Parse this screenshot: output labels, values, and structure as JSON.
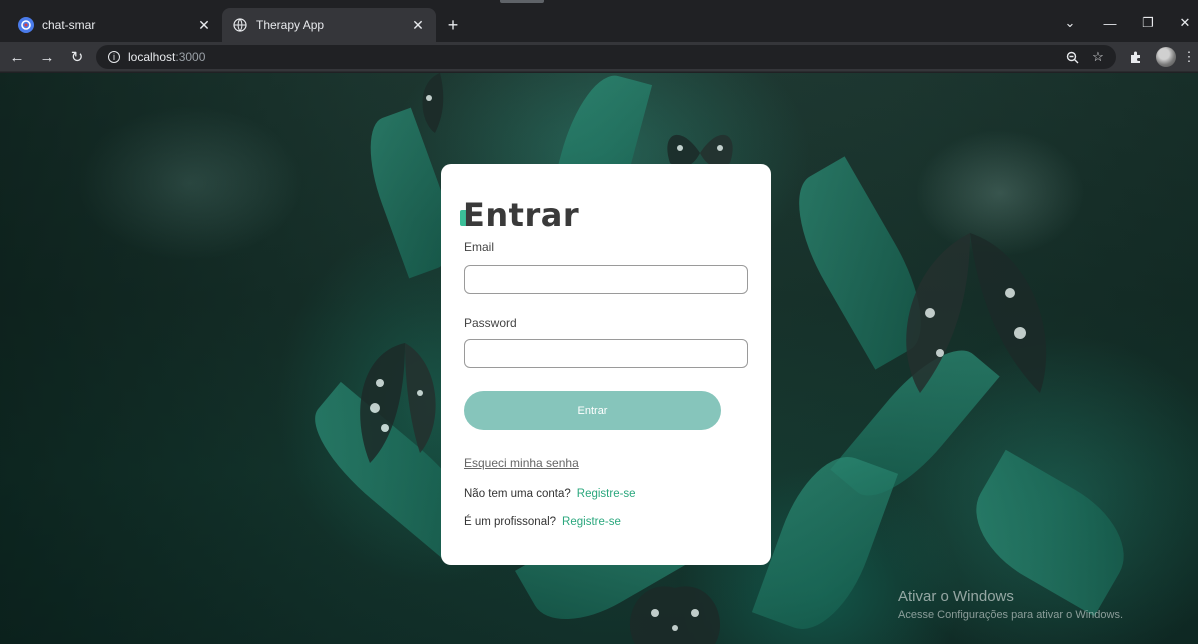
{
  "browser": {
    "tabs": [
      {
        "title": "chat-smar",
        "active": false
      },
      {
        "title": "Therapy App",
        "active": true
      }
    ],
    "url": {
      "host": "localhost",
      "port": ":3000"
    }
  },
  "login": {
    "heading": "Entrar",
    "email_label": "Email",
    "email_value": "",
    "password_label": "Password",
    "password_value": "",
    "submit_label": "Entrar",
    "forgot_link": "Esqueci minha senha",
    "no_account_text": "Não tem uma conta?",
    "register_link": "Registre-se",
    "professional_text": "É um profissonal?",
    "professional_register_link": "Registre-se"
  },
  "watermark": {
    "title": "Ativar o Windows",
    "subtitle": "Acesse Configurações para ativar o Windows."
  },
  "colors": {
    "accent": "#2aa77d",
    "button": "#86c5bb",
    "heading": "#3a3a3a"
  }
}
